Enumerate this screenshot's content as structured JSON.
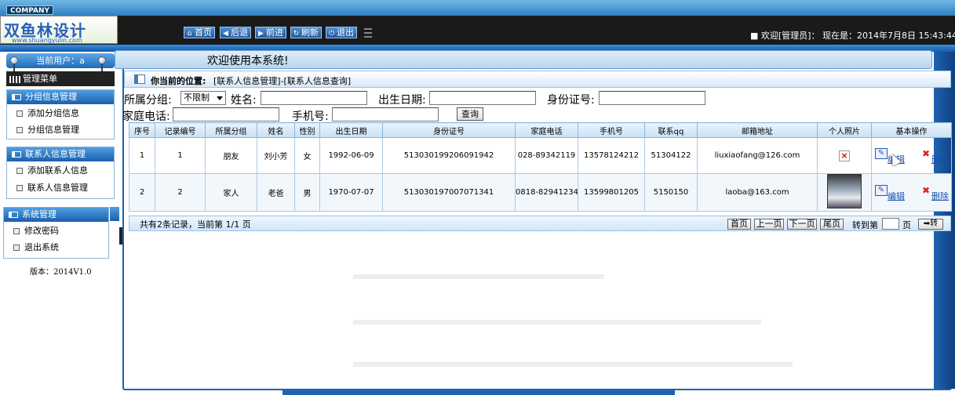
{
  "header": {
    "company": "COMPANY",
    "logo_text": "双鱼林设计",
    "logo_sub": "www.shuangyulin.com",
    "nav": [
      {
        "icon": "home-icon",
        "glyph": "⌂",
        "label": "首页"
      },
      {
        "icon": "back-arrow-icon",
        "glyph": "◀",
        "label": "后退"
      },
      {
        "icon": "forward-arrow-icon",
        "glyph": "▶",
        "label": "前进"
      },
      {
        "icon": "refresh-icon",
        "glyph": "↻",
        "label": "刷新"
      },
      {
        "icon": "power-icon",
        "glyph": "⏻",
        "label": "退出"
      }
    ],
    "welcome_text": "■ 欢迎[管理员]：  现在是：2014年7月8日 15:43:44"
  },
  "sidebar": {
    "current_user": "当前用户：a",
    "menu_title": "管理菜单",
    "sections": [
      {
        "title": "分组信息管理",
        "items": [
          "添加分组信息",
          "分组信息管理"
        ]
      },
      {
        "title": "联系人信息管理",
        "items": [
          "添加联系人信息",
          "联系人信息管理"
        ]
      },
      {
        "title": "系统管理",
        "items": [
          "修改密码",
          "退出系统"
        ]
      }
    ],
    "version": "版本：2014V1.0"
  },
  "main": {
    "welcome": "欢迎使用本系统!",
    "location_label": "你当前的位置:",
    "location_path": "[联系人信息管理]-[联系人信息查询]"
  },
  "search": {
    "group_label": "所属分组:",
    "group_value": "不限制",
    "name_label": "姓名:",
    "birth_label": "出生日期:",
    "id_label": "身份证号:",
    "home_phone_label": "家庭电话:",
    "mobile_label": "手机号:",
    "query_button": "查询"
  },
  "table": {
    "columns": [
      "序号",
      "记录编号",
      "所属分组",
      "姓名",
      "性别",
      "出生日期",
      "身份证号",
      "家庭电话",
      "手机号",
      "联系qq",
      "邮箱地址",
      "个人照片",
      "基本操作"
    ],
    "rows": [
      {
        "seq": "1",
        "record_id": "1",
        "group": "朋友",
        "name": "刘小芳",
        "gender": "女",
        "birth": "1992-06-09",
        "id_no": "513030199206091942",
        "home_phone": "028-89342119",
        "mobile": "13578124212",
        "qq": "51304122",
        "email": "liuxiaofang@126.com",
        "photo": "broken"
      },
      {
        "seq": "2",
        "record_id": "2",
        "group": "家人",
        "name": "老爸",
        "gender": "男",
        "birth": "1970-07-07",
        "id_no": "513030197007071341",
        "home_phone": "0818-82941234",
        "mobile": "13599801205",
        "qq": "5150150",
        "email": "laoba@163.com",
        "photo": "image"
      }
    ],
    "edit_label": "编辑",
    "delete_label": "删除",
    "broken_image_glyph": "×"
  },
  "pager": {
    "info": "共有2条记录，当前第 1/1 页",
    "first": "首页",
    "prev": "上一页",
    "next": "下一页",
    "last": "尾页",
    "goto_label": "转到第",
    "page_label": "页",
    "go": "➡转"
  }
}
